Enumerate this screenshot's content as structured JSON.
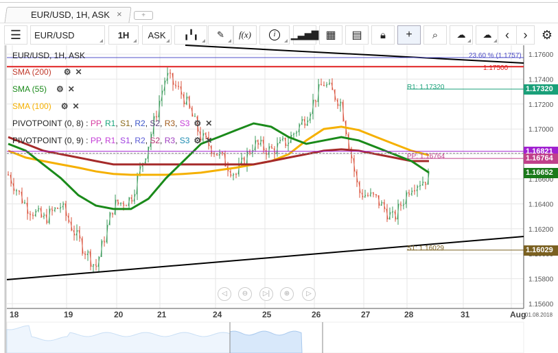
{
  "tab": {
    "title": "EUR/USD, 1H, ASK",
    "close": "×",
    "new": "+"
  },
  "toolbar": {
    "symbol": "EUR/USD",
    "timeframe": "1H",
    "side": "ASK",
    "fx": "f(x)",
    "info": "i"
  },
  "chart": {
    "title": "EUR/USD, 1H, ASK",
    "indicators": [
      {
        "label": "SMA (200)",
        "color": "#c0392b"
      },
      {
        "label": "SMA (55)",
        "color": "#1a8a1a"
      },
      {
        "label": "SMA (100)",
        "color": "#f5b000"
      }
    ],
    "pivot1": {
      "label": "PIVOTPOINT (0, 8)",
      "sep": " : ",
      "items": [
        [
          "PP",
          "#d63ca0"
        ],
        [
          "R1",
          "#17a37a"
        ],
        [
          "S1",
          "#8a6a1a"
        ],
        [
          "R2",
          "#3b55c8"
        ],
        [
          "S2",
          "#5a3c7a"
        ],
        [
          "R3",
          "#a05a1a"
        ],
        [
          "S3",
          "#c33bd6"
        ]
      ]
    },
    "pivot2": {
      "label": "PIVOTPOINT (0, 9)",
      "sep": " : ",
      "items": [
        [
          "PP",
          "#c33bd6"
        ],
        [
          "R1",
          "#c33bd6"
        ],
        [
          "S1",
          "#a040e0"
        ],
        [
          "R2",
          "#5a5ad6"
        ],
        [
          "S2",
          "#b03070"
        ],
        [
          "R3",
          "#a040c0"
        ],
        [
          "S3",
          "#1a8ab0"
        ]
      ]
    },
    "gear": "⚙",
    "x": "✕",
    "fib_label": "23.60 % (1.1757)",
    "hline_label": "1.17500",
    "r1_label": "R1: 1.17320",
    "pp_label": "PP: 1.16764",
    "s1_label": "S1: 1.16029",
    "y_ticks": [
      "1.17600",
      "1.17400",
      "1.17200",
      "1.17000",
      "1.16800",
      "1.16600",
      "1.16400",
      "1.16200",
      "1.16000",
      "1.15800",
      "1.15600"
    ],
    "tags": [
      {
        "text": "1.17320",
        "color": "#1aa079",
        "price": 1.1732
      },
      {
        "text": "1.16821",
        "color": "#a020d0",
        "price": 1.16821
      },
      {
        "text": "1.16764",
        "color": "#c0408a",
        "price": 1.16764
      },
      {
        "text": "1.16652",
        "color": "#1a7a1a",
        "price": 1.16652
      },
      {
        "text": "1.16029",
        "color": "#7a6020",
        "price": 1.16029
      }
    ],
    "x_ticks": [
      "18",
      "19",
      "20",
      "21",
      "24",
      "25",
      "26",
      "27",
      "28",
      "31",
      "Aug"
    ],
    "date_label": "01.08.2018",
    "price_path": [
      1.16633,
      1.16386,
      1.16276,
      1.16386,
      1.16111,
      1.15891,
      1.16386,
      1.16441,
      1.16881,
      1.1743,
      1.17265,
      1.16935,
      1.16798,
      1.16633,
      1.16881,
      1.16826,
      1.16908,
      1.171,
      1.17375,
      1.1721,
      1.16496,
      1.16441,
      1.16276,
      1.16551,
      1.16606
    ],
    "sma55": [
      1.16881,
      1.16826,
      1.16716,
      1.16606,
      1.16469,
      1.16386,
      1.16359,
      1.16359,
      1.16441,
      1.16606,
      1.16743,
      1.16881,
      1.16935,
      1.16991,
      1.17045,
      1.17018,
      1.16935,
      1.16881,
      1.16908,
      1.16935,
      1.16908,
      1.16853,
      1.16798,
      1.16743,
      1.1665
    ],
    "sma200": [
      1.16935,
      1.16881,
      1.16826,
      1.16798,
      1.16771,
      1.16743,
      1.16716,
      1.16716,
      1.16716,
      1.16716,
      1.16716,
      1.16716,
      1.16716,
      1.16716,
      1.16716,
      1.16743,
      1.16771,
      1.16798,
      1.16826,
      1.16837,
      1.16826,
      1.16798,
      1.16771,
      1.16743,
      1.16743
    ],
    "sma100": [
      1.16826,
      1.16771,
      1.16743,
      1.16716,
      1.1669,
      1.1666,
      1.1664,
      1.16633,
      1.16633,
      1.16633,
      1.1664,
      1.1665,
      1.1667,
      1.1669,
      1.16716,
      1.16743,
      1.16798,
      1.16908,
      1.17,
      1.17018,
      1.16991,
      1.16935,
      1.1688,
      1.16826,
      1.1679
    ]
  }
}
